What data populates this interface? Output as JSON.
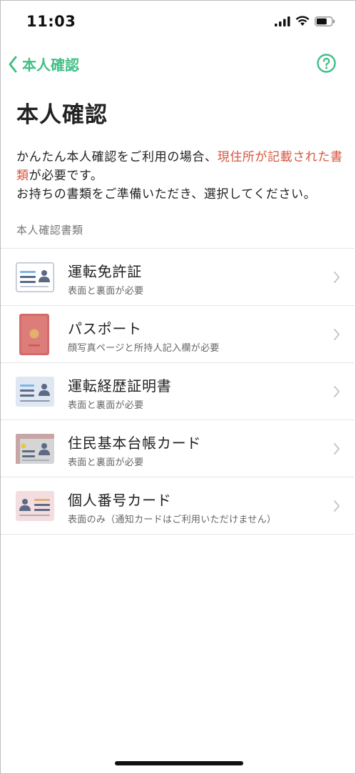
{
  "status_bar": {
    "time": "11:03"
  },
  "nav": {
    "back_label": "本人確認",
    "help_icon": "question-circle-icon"
  },
  "page": {
    "title": "本人確認",
    "intro": {
      "line1_prefix": "かんたん本人確認をご利用の場合、",
      "highlight": "現住所が記載された書類",
      "line1_suffix": "が必要です。",
      "line2": "お持ちの書類をご準備いただき、選択してください。"
    },
    "section_label": "本人確認書類"
  },
  "colors": {
    "accent": "#3fbf86",
    "warning": "#d8553f"
  },
  "documents": [
    {
      "name": "運転免許証",
      "note": "表面と裏面が必要",
      "icon": "license-card-icon"
    },
    {
      "name": "パスポート",
      "note": "顔写真ページと所持人記入欄が必要",
      "icon": "passport-icon"
    },
    {
      "name": "運転経歴証明書",
      "note": "表面と裏面が必要",
      "icon": "driving-record-card-icon"
    },
    {
      "name": "住民基本台帳カード",
      "note": "表面と裏面が必要",
      "icon": "resident-card-icon"
    },
    {
      "name": "個人番号カード",
      "note": "表面のみ（通知カードはご利用いただけません）",
      "icon": "my-number-card-icon"
    }
  ]
}
